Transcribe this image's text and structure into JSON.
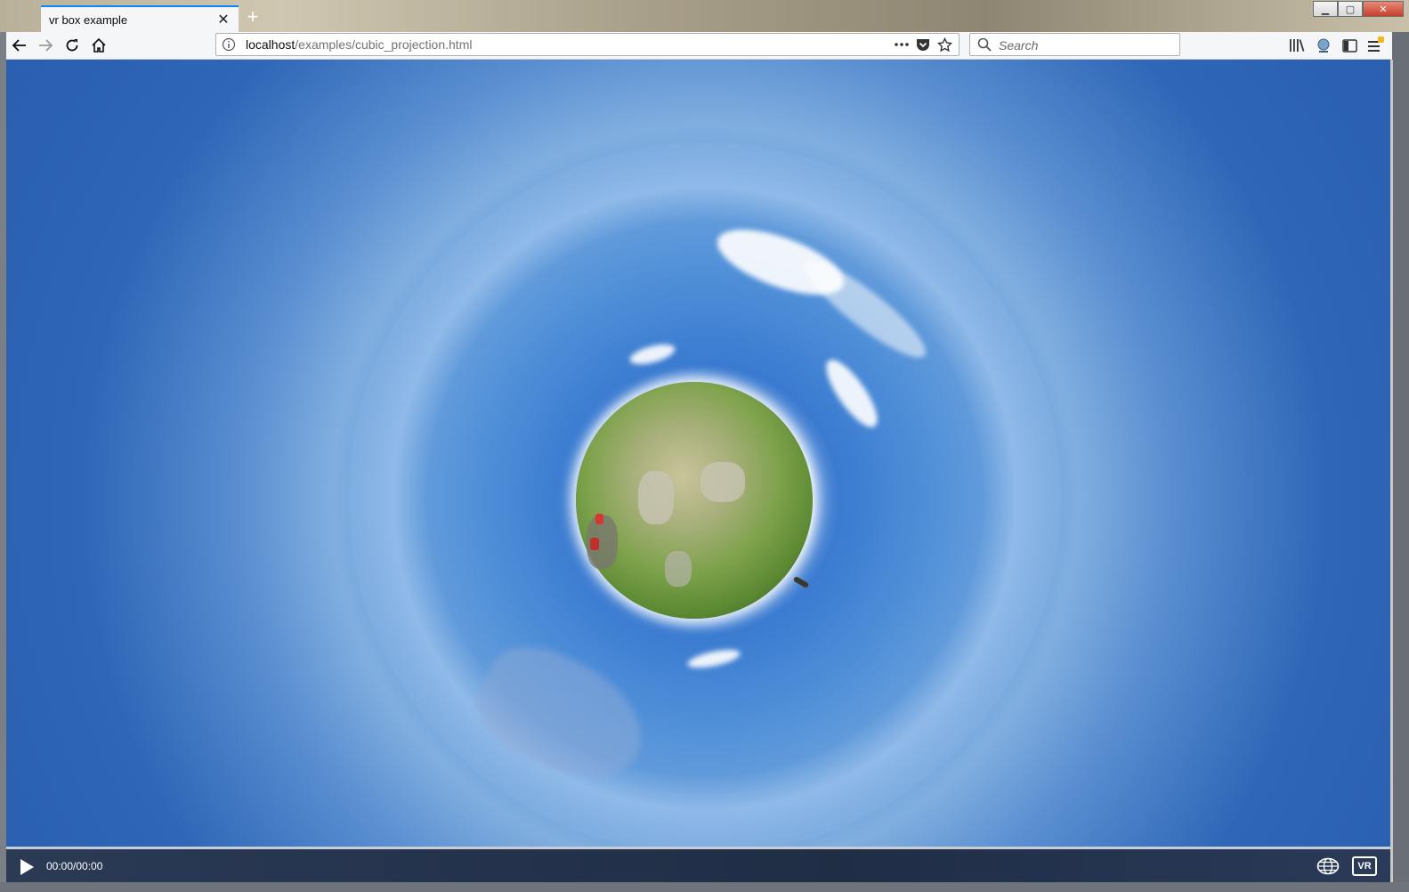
{
  "browser": {
    "tab": {
      "title": "vr box example"
    },
    "url": {
      "host": "localhost",
      "path": "/examples/cubic_projection.html"
    },
    "search": {
      "placeholder": "Search"
    }
  },
  "player": {
    "time": "00:00/00:00",
    "vr_label": "VR"
  },
  "colors": {
    "accent": "#0a84ff",
    "sky": "#3a7ad0",
    "control_bar": "#1f2d45"
  },
  "icons": [
    "back-icon",
    "forward-icon",
    "reload-icon",
    "home-icon",
    "info-icon",
    "more-icon",
    "pocket-icon",
    "bookmark-star-icon",
    "search-icon",
    "library-icon",
    "extension-icon",
    "sidebar-icon",
    "menu-icon",
    "play-icon",
    "globe-icon"
  ]
}
